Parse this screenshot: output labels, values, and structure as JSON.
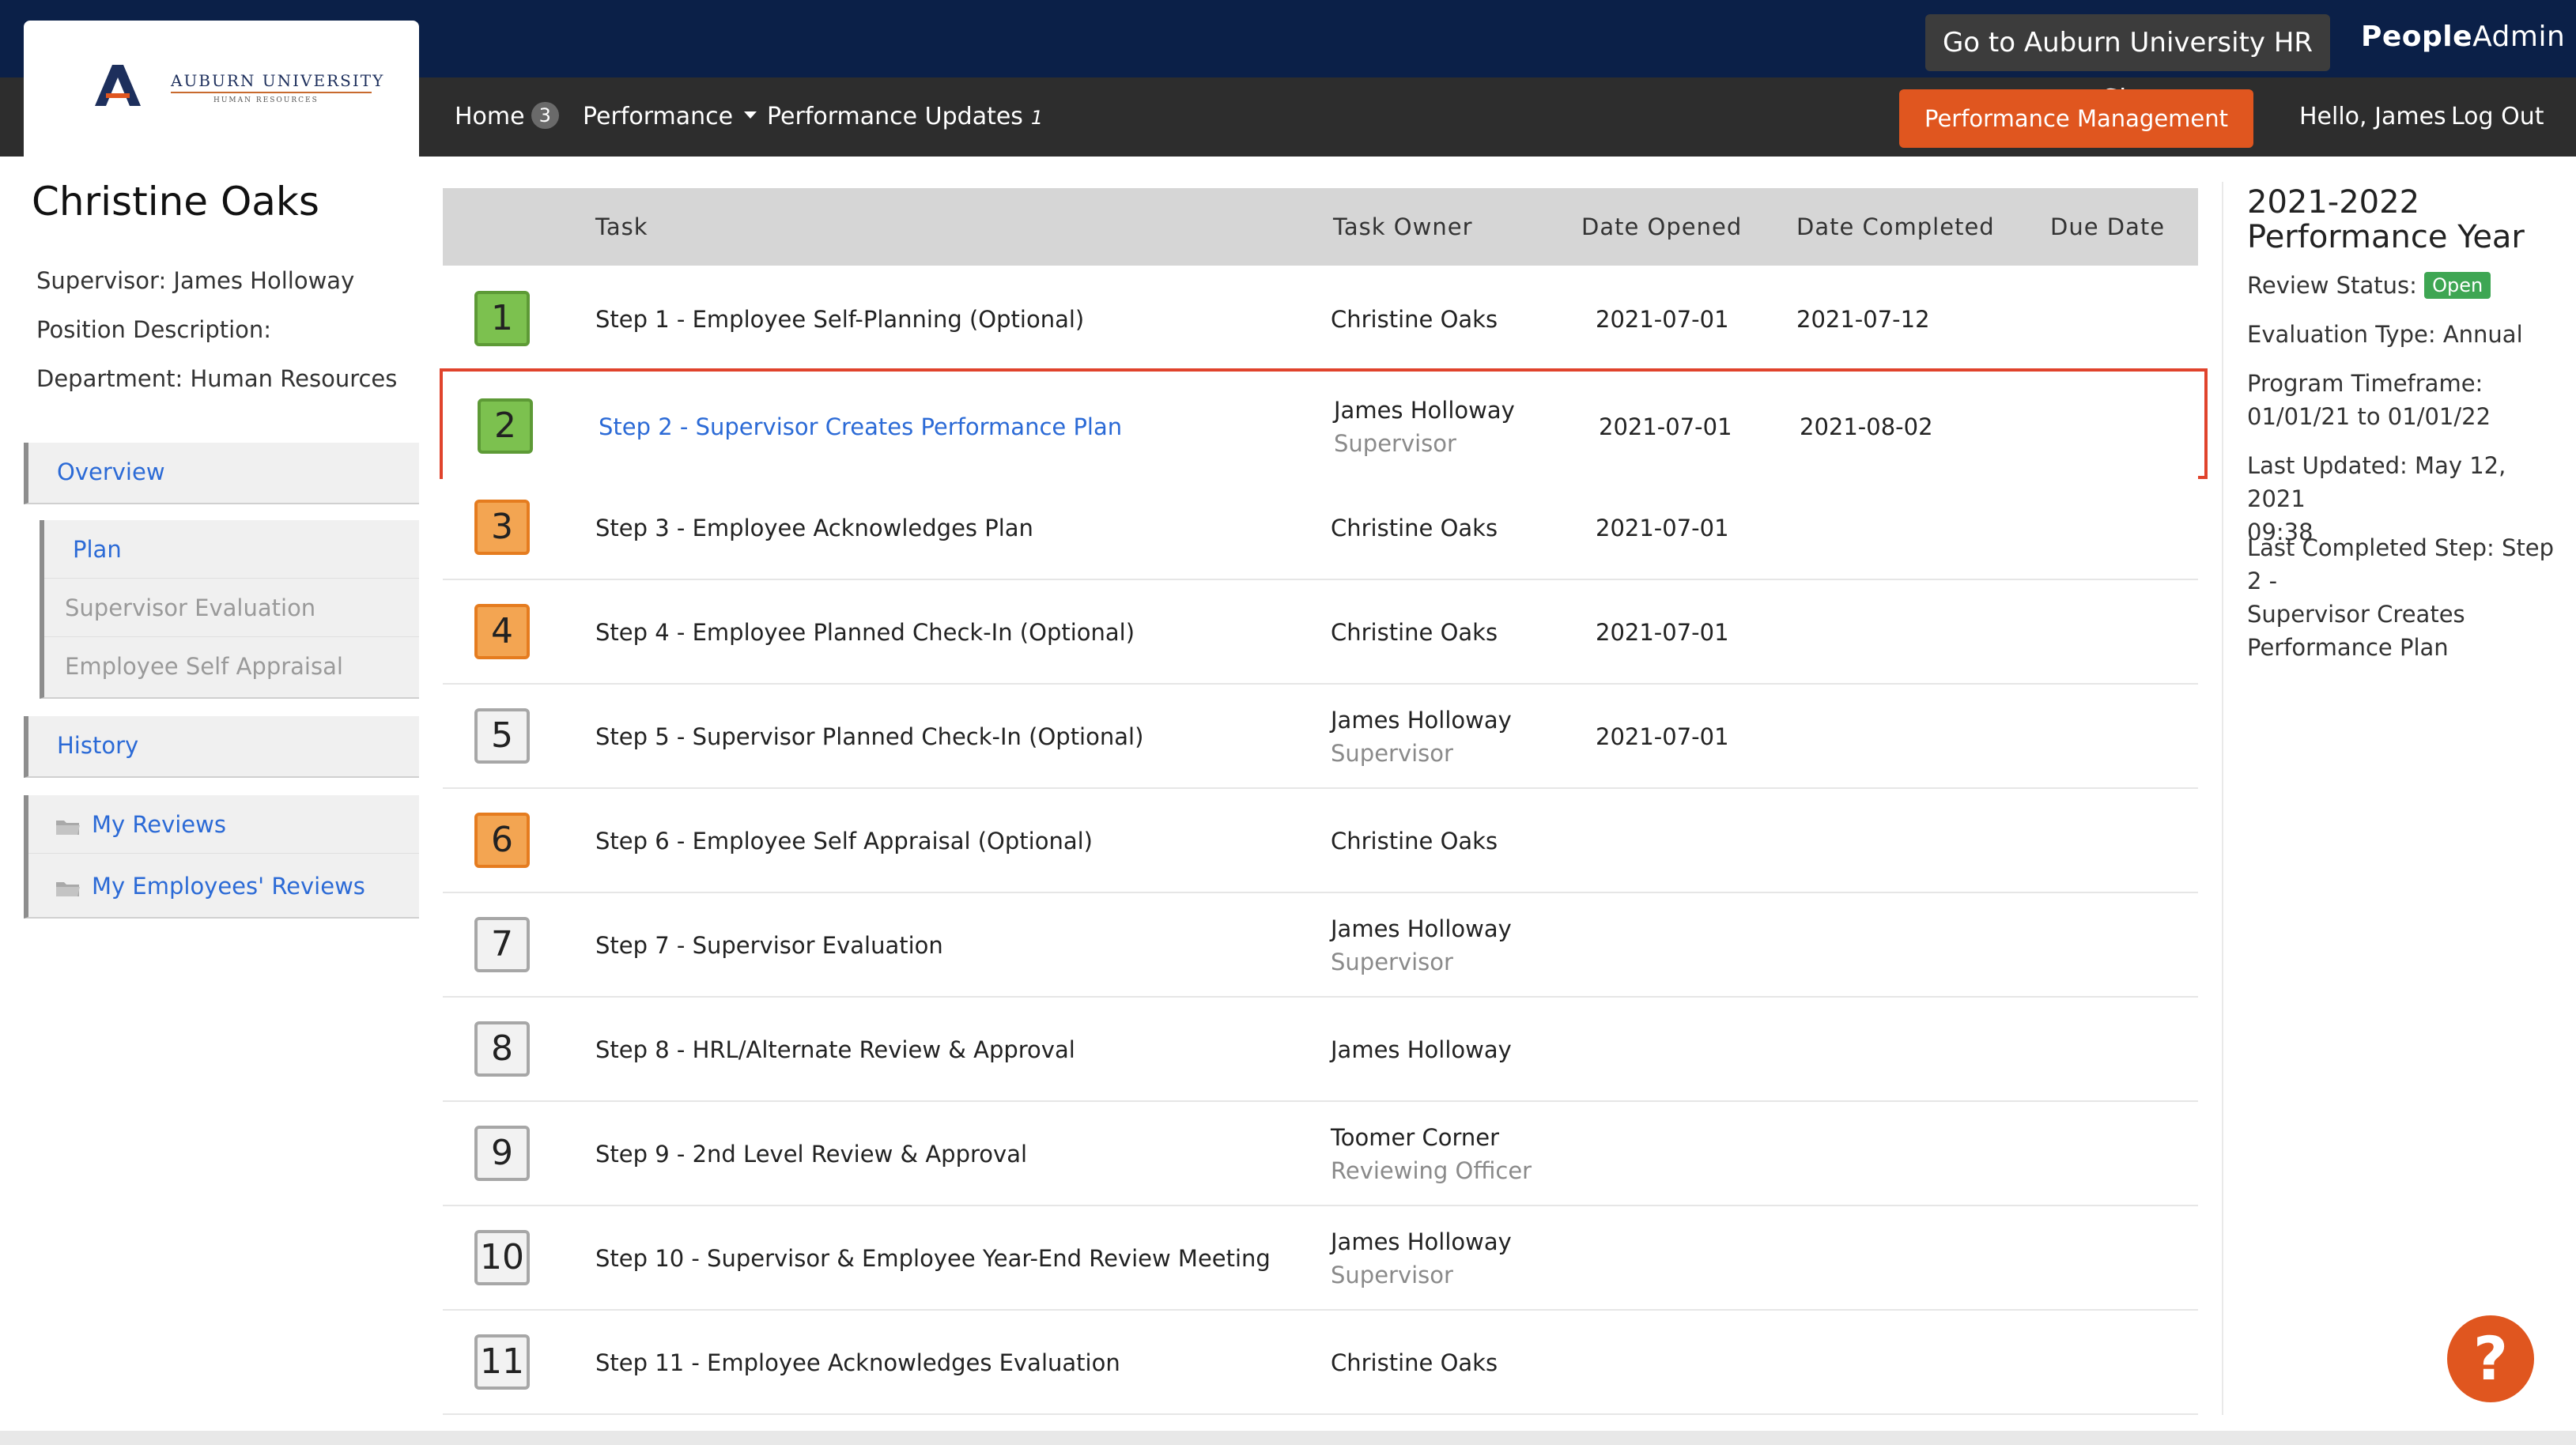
{
  "header": {
    "hr_site_button": "Go to Auburn University HR Site",
    "brand_bold": "People",
    "brand_rest": "Admin",
    "help_button": "Performance Management Help",
    "greeting": "Hello, James",
    "logout": "Log Out"
  },
  "logo": {
    "mark": "AU",
    "name": "AUBURN UNIVERSITY",
    "sub": "HUMAN RESOURCES"
  },
  "nav": {
    "home_label": "Home",
    "home_badge": "3",
    "performance_label": "Performance",
    "updates_label": "Performance Updates",
    "updates_count": "1"
  },
  "employee": {
    "name": "Christine Oaks",
    "supervisor": "Supervisor: James Holloway",
    "position": "Position Description:",
    "department": "Department: Human Resources"
  },
  "sidebar": {
    "overview": "Overview",
    "plan": "Plan",
    "supervisor_evaluation": "Supervisor Evaluation",
    "self_appraisal": "Employee Self Appraisal",
    "history": "History",
    "my_reviews": "My Reviews",
    "my_employees_reviews": "My Employees' Reviews"
  },
  "table": {
    "headers": {
      "task": "Task",
      "owner": "Task Owner",
      "opened": "Date Opened",
      "completed": "Date Completed",
      "due": "Due Date"
    },
    "rows": [
      {
        "num": "1",
        "task": "Step 1 - Employee Self-Planning (Optional)",
        "owner": "Christine Oaks",
        "role": "",
        "opened": "2021-07-01",
        "completed": "2021-07-12",
        "due": ""
      },
      {
        "num": "2",
        "task": "Step 2 - Supervisor Creates Performance Plan",
        "owner": "James Holloway",
        "role": "Supervisor",
        "opened": "2021-07-01",
        "completed": "2021-08-02",
        "due": ""
      },
      {
        "num": "3",
        "task": "Step 3 - Employee Acknowledges Plan",
        "owner": "Christine Oaks",
        "role": "",
        "opened": "2021-07-01",
        "completed": "",
        "due": ""
      },
      {
        "num": "4",
        "task": "Step 4 - Employee Planned Check-In (Optional)",
        "owner": "Christine Oaks",
        "role": "",
        "opened": "2021-07-01",
        "completed": "",
        "due": ""
      },
      {
        "num": "5",
        "task": "Step 5 - Supervisor Planned Check-In (Optional)",
        "owner": "James Holloway",
        "role": "Supervisor",
        "opened": "2021-07-01",
        "completed": "",
        "due": ""
      },
      {
        "num": "6",
        "task": "Step 6 - Employee Self Appraisal (Optional)",
        "owner": "Christine Oaks",
        "role": "",
        "opened": "",
        "completed": "",
        "due": ""
      },
      {
        "num": "7",
        "task": "Step 7 - Supervisor Evaluation",
        "owner": "James Holloway",
        "role": "Supervisor",
        "opened": "",
        "completed": "",
        "due": ""
      },
      {
        "num": "8",
        "task": "Step 8 - HRL/Alternate Review & Approval",
        "owner": "James Holloway",
        "role": "",
        "opened": "",
        "completed": "",
        "due": ""
      },
      {
        "num": "9",
        "task": "Step 9 - 2nd Level Review & Approval",
        "owner": "Toomer Corner",
        "role": "Reviewing Officer",
        "opened": "",
        "completed": "",
        "due": ""
      },
      {
        "num": "10",
        "task": "Step 10 - Supervisor & Employee Year-End Review Meeting",
        "owner": "James Holloway",
        "role": "Supervisor",
        "opened": "",
        "completed": "",
        "due": ""
      },
      {
        "num": "11",
        "task": "Step 11 - Employee Acknowledges Evaluation",
        "owner": "Christine Oaks",
        "role": "",
        "opened": "",
        "completed": "",
        "due": ""
      }
    ]
  },
  "summary": {
    "title_line1": "2021-2022",
    "title_line2": "Performance Year",
    "review_status_label": "Review Status:",
    "review_status_value": "Open",
    "evaluation_type": "Evaluation Type: Annual",
    "timeframe_label": "Program Timeframe:",
    "timeframe_value": "01/01/21 to 01/01/22",
    "last_updated_1": "Last Updated: May 12, 2021",
    "last_updated_2": "09:38",
    "last_step_1": "Last Completed Step: Step 2 -",
    "last_step_2": "Supervisor Creates",
    "last_step_3": "Performance Plan"
  },
  "help_bubble": "?",
  "colors": {
    "topbar": "#0b2048",
    "navbar": "#2d2d2d",
    "accent_orange": "#e0561f",
    "link_blue": "#2b6ad6",
    "status_green": "#3ea653",
    "highlight_red": "#e0432c"
  }
}
